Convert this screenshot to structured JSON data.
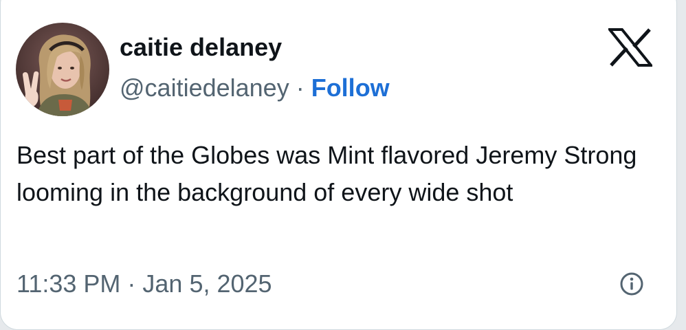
{
  "author": {
    "display_name": "caitie delaney",
    "handle": "@caitiedelaney",
    "separator": "·",
    "follow_label": "Follow"
  },
  "tweet": {
    "text": "Best part of the Globes was Mint flavored Jeremy Strong looming in the background of every wide shot",
    "timestamp": "11:33 PM · Jan 5, 2025"
  },
  "icons": {
    "logo": "x-logo-icon",
    "info": "info-icon"
  },
  "colors": {
    "text": "#0f1419",
    "secondary": "#536471",
    "follow": "#1d6fd6",
    "border": "#cfd9de",
    "background": "#ffffff"
  }
}
